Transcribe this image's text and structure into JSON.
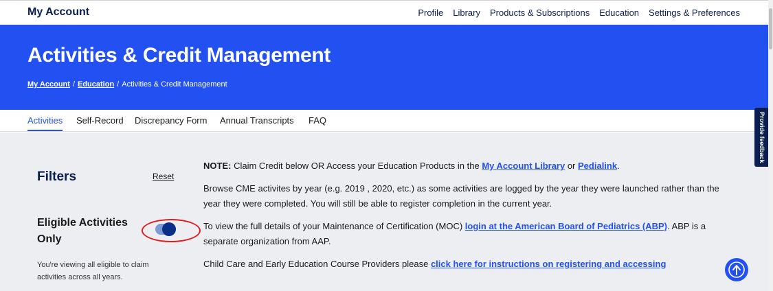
{
  "header": {
    "brand": "My Account",
    "nav": [
      "Profile",
      "Library",
      "Products & Subscriptions",
      "Education",
      "Settings & Preferences"
    ]
  },
  "hero": {
    "title": "Activities & Credit Management",
    "breadcrumb": [
      {
        "label": "My Account"
      },
      {
        "label": "Education"
      },
      {
        "label": "Activities & Credit Management"
      }
    ],
    "separator": "/"
  },
  "tabs": [
    {
      "label": "Activities",
      "active": true
    },
    {
      "label": "Self-Record"
    },
    {
      "label": "Discrepancy Form"
    },
    {
      "label": "Annual Transcripts"
    },
    {
      "label": "FAQ"
    }
  ],
  "filters": {
    "title": "Filters",
    "reset_label": "Reset",
    "eligible_label": "Eligible Activities Only",
    "eligible_toggle_on": true,
    "hint": "You're viewing all eligible to claim activities across all years."
  },
  "main": {
    "note_label": "NOTE:",
    "note_text": " Claim Credit below OR Access your Education Products in the ",
    "note_link1": "My Account Library",
    "note_or": " or ",
    "note_link2": "Pedialink",
    "note_end": ".",
    "browse_text": "Browse CME activites by year (e.g. 2019 , 2020, etc.) as some activities are logged by the year they were launched rather than the year they were completed. You will still be able to register completion in the current year.",
    "moc_text": "To view the full details of your Maintenance of Certification (MOC) ",
    "moc_link": "login at the American Board of Pediatrics (ABP)",
    "moc_end": ". ABP is a separate organization from AAP.",
    "childcare_text": "Child Care and Early Education Course Providers please ",
    "childcare_link": "click here for instructions on registering and accessing"
  },
  "feedback_label": "Provide feedback",
  "icons": {
    "fab": "up-arrow-icon"
  },
  "colors": {
    "hero": "#2350f0",
    "navy": "#0a1e4f",
    "highlight": "#e21b1b"
  }
}
